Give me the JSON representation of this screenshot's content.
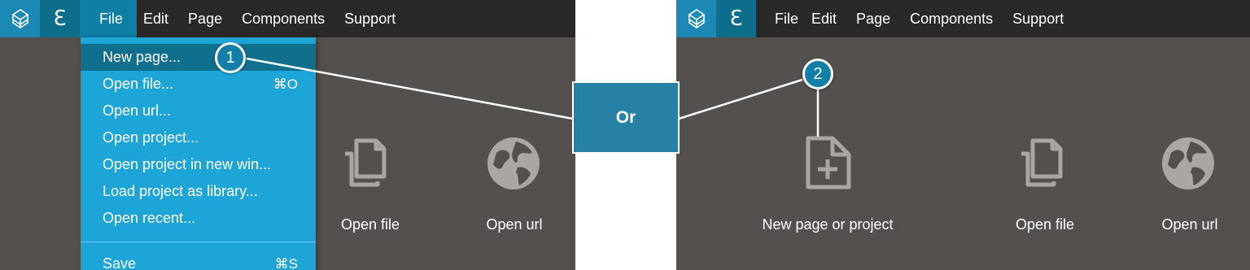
{
  "left": {
    "menu": {
      "file": "File",
      "edit": "Edit",
      "page": "Page",
      "components": "Components",
      "support": "Support"
    },
    "file_menu": {
      "items": [
        {
          "label": "New page...",
          "shortcut": ""
        },
        {
          "label": "Open file...",
          "shortcut": "⌘O"
        },
        {
          "label": "Open url...",
          "shortcut": ""
        },
        {
          "label": "Open project...",
          "shortcut": ""
        },
        {
          "label": "Open project in new win...",
          "shortcut": ""
        },
        {
          "label": "Load project as library...",
          "shortcut": ""
        },
        {
          "label": "Open recent...",
          "shortcut": ""
        },
        {
          "label": "Save",
          "shortcut": "⌘S"
        }
      ]
    },
    "tiles": {
      "open_file": "Open file",
      "open_url": "Open url"
    },
    "badge": "1"
  },
  "or_label": "Or",
  "right": {
    "menu": {
      "file": "File",
      "edit": "Edit",
      "page": "Page",
      "components": "Components",
      "support": "Support"
    },
    "tiles": {
      "new_page": "New page or project",
      "open_file": "Open file",
      "open_url": "Open url"
    },
    "badge": "2"
  },
  "colors": {
    "workspace": "#54504d",
    "menubar": "#2a2927",
    "menu_dropdown": "#1ea5d8",
    "menu_highlight": "#0f6f8d",
    "badge": "#137fa8",
    "or_box": "#2781a5"
  },
  "icons": [
    "pinecone-logo-icon",
    "e-mode-icon",
    "file-copy-icon",
    "globe-icon",
    "new-page-icon"
  ]
}
